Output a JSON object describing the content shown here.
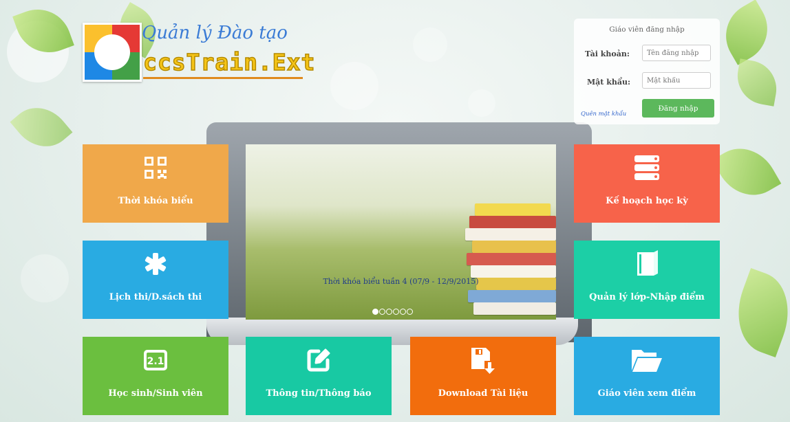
{
  "logo": {
    "title": "Quản lý Đào tạo",
    "subtitle": "ccsTrain.Ext"
  },
  "login": {
    "heading": "Giáo viên đăng nhập",
    "username_label": "Tài khoản:",
    "username_placeholder": "Tên đăng nhập",
    "password_label": "Mật khẩu:",
    "password_placeholder": "Mật khẩu",
    "forgot_label": "Quên mật khẩu",
    "submit_label": "Đăng nhập"
  },
  "carousel": {
    "caption": "Thời khóa biểu tuần 4 (07/9 - 12/9/2015)",
    "slide_count": 6,
    "active_index": 0
  },
  "tiles": {
    "timetable": {
      "label": "Thời khóa biểu",
      "color": "#f0a84a",
      "icon": "qr-code-icon"
    },
    "semester_plan": {
      "label": "Kế hoạch học kỳ",
      "color": "#f7634a",
      "icon": "server-stack-icon"
    },
    "exam_schedule": {
      "label": "Lịch thi/D.sách thi",
      "color": "#29abe2",
      "icon": "asterisk-icon"
    },
    "class_management": {
      "label": "Quản lý lớp-Nhập điểm",
      "color": "#1ccfa6",
      "icon": "book-icon"
    },
    "students": {
      "label": "Học sinh/Sinh viên",
      "color": "#6bbf3f",
      "icon": "id-card-icon"
    },
    "announcements": {
      "label": "Thông tin/Thông báo",
      "color": "#18c9a3",
      "icon": "edit-icon"
    },
    "download_docs": {
      "label": "Download Tài liệu",
      "color": "#f26d0d",
      "icon": "download-save-icon"
    },
    "teacher_grades": {
      "label": "Giáo viên xem điểm",
      "color": "#29abe2",
      "icon": "folder-open-icon"
    }
  }
}
